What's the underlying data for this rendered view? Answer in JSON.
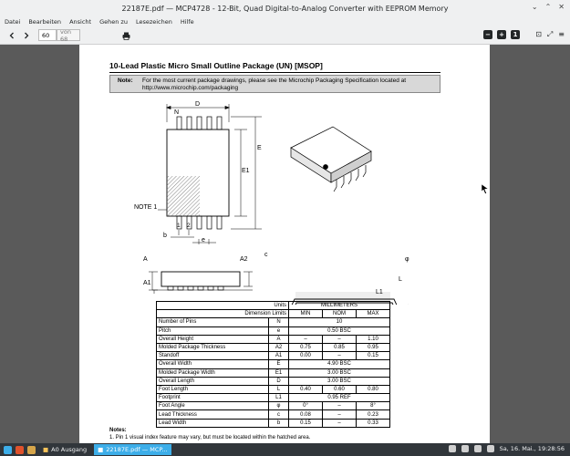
{
  "window": {
    "title": "22187E.pdf — MCP4728 - 12-Bit, Quad Digital-to-Analog Converter with EEPROM Memory"
  },
  "menu": [
    "Datei",
    "Bearbeiten",
    "Ansicht",
    "Gehen zu",
    "Lesezeichen",
    "Hilfe"
  ],
  "toolbar": {
    "current_page": "60",
    "page_of": "von 68"
  },
  "document": {
    "title": "10-Lead Plastic Micro Small Outline Package (UN) [MSOP]",
    "note_label": "Note:",
    "note_text": "For the most current package drawings, please see the Microchip Packaging Specification located at http://www.microchip.com/packaging",
    "drawing_labels": {
      "D": "D",
      "N": "N",
      "E": "E",
      "E1": "E1",
      "note1": "NOTE 1",
      "pin1": "1",
      "pin2": "2",
      "b": "b",
      "e": "e",
      "A": "A",
      "A2": "A2",
      "A1": "A1",
      "c": "c",
      "phi": "φ",
      "L": "L",
      "L1": "L1"
    },
    "table": {
      "units_label": "Units",
      "units_value": "MILLIMETERS",
      "limits_label": "Dimension Limits",
      "min": "MIN",
      "nom": "NOM",
      "max": "MAX",
      "rows": [
        {
          "name": "Number of Pins",
          "sym": "N",
          "span": "10"
        },
        {
          "name": "Pitch",
          "sym": "e",
          "span": "0.50 BSC"
        },
        {
          "name": "Overall Height",
          "sym": "A",
          "min": "–",
          "nom": "–",
          "max": "1.10"
        },
        {
          "name": "Molded Package Thickness",
          "sym": "A2",
          "min": "0.75",
          "nom": "0.85",
          "max": "0.95"
        },
        {
          "name": "Standoff",
          "sym": "A1",
          "min": "0.00",
          "nom": "–",
          "max": "0.15"
        },
        {
          "name": "Overall Width",
          "sym": "E",
          "span": "4.90 BSC"
        },
        {
          "name": "Molded Package Width",
          "sym": "E1",
          "span": "3.00 BSC"
        },
        {
          "name": "Overall Length",
          "sym": "D",
          "span": "3.00 BSC"
        },
        {
          "name": "Foot Length",
          "sym": "L",
          "min": "0.40",
          "nom": "0.60",
          "max": "0.80"
        },
        {
          "name": "Footprint",
          "sym": "L1",
          "span": "0.95 REF"
        },
        {
          "name": "Foot Angle",
          "sym": "φ",
          "min": "0°",
          "nom": "–",
          "max": "8°"
        },
        {
          "name": "Lead Thickness",
          "sym": "c",
          "min": "0.08",
          "nom": "–",
          "max": "0.23"
        },
        {
          "name": "Lead Width",
          "sym": "b",
          "min": "0.15",
          "nom": "–",
          "max": "0.33"
        }
      ]
    },
    "notes_head": "Notes:",
    "notes": [
      "1.  Pin 1 visual index feature may vary, but must be located within the hatched area."
    ]
  },
  "taskbar": {
    "tasks": [
      "A0 Ausgang",
      "22187E.pdf — MCP..."
    ],
    "clock": "Sa, 16. Mai., 19:28:56"
  }
}
